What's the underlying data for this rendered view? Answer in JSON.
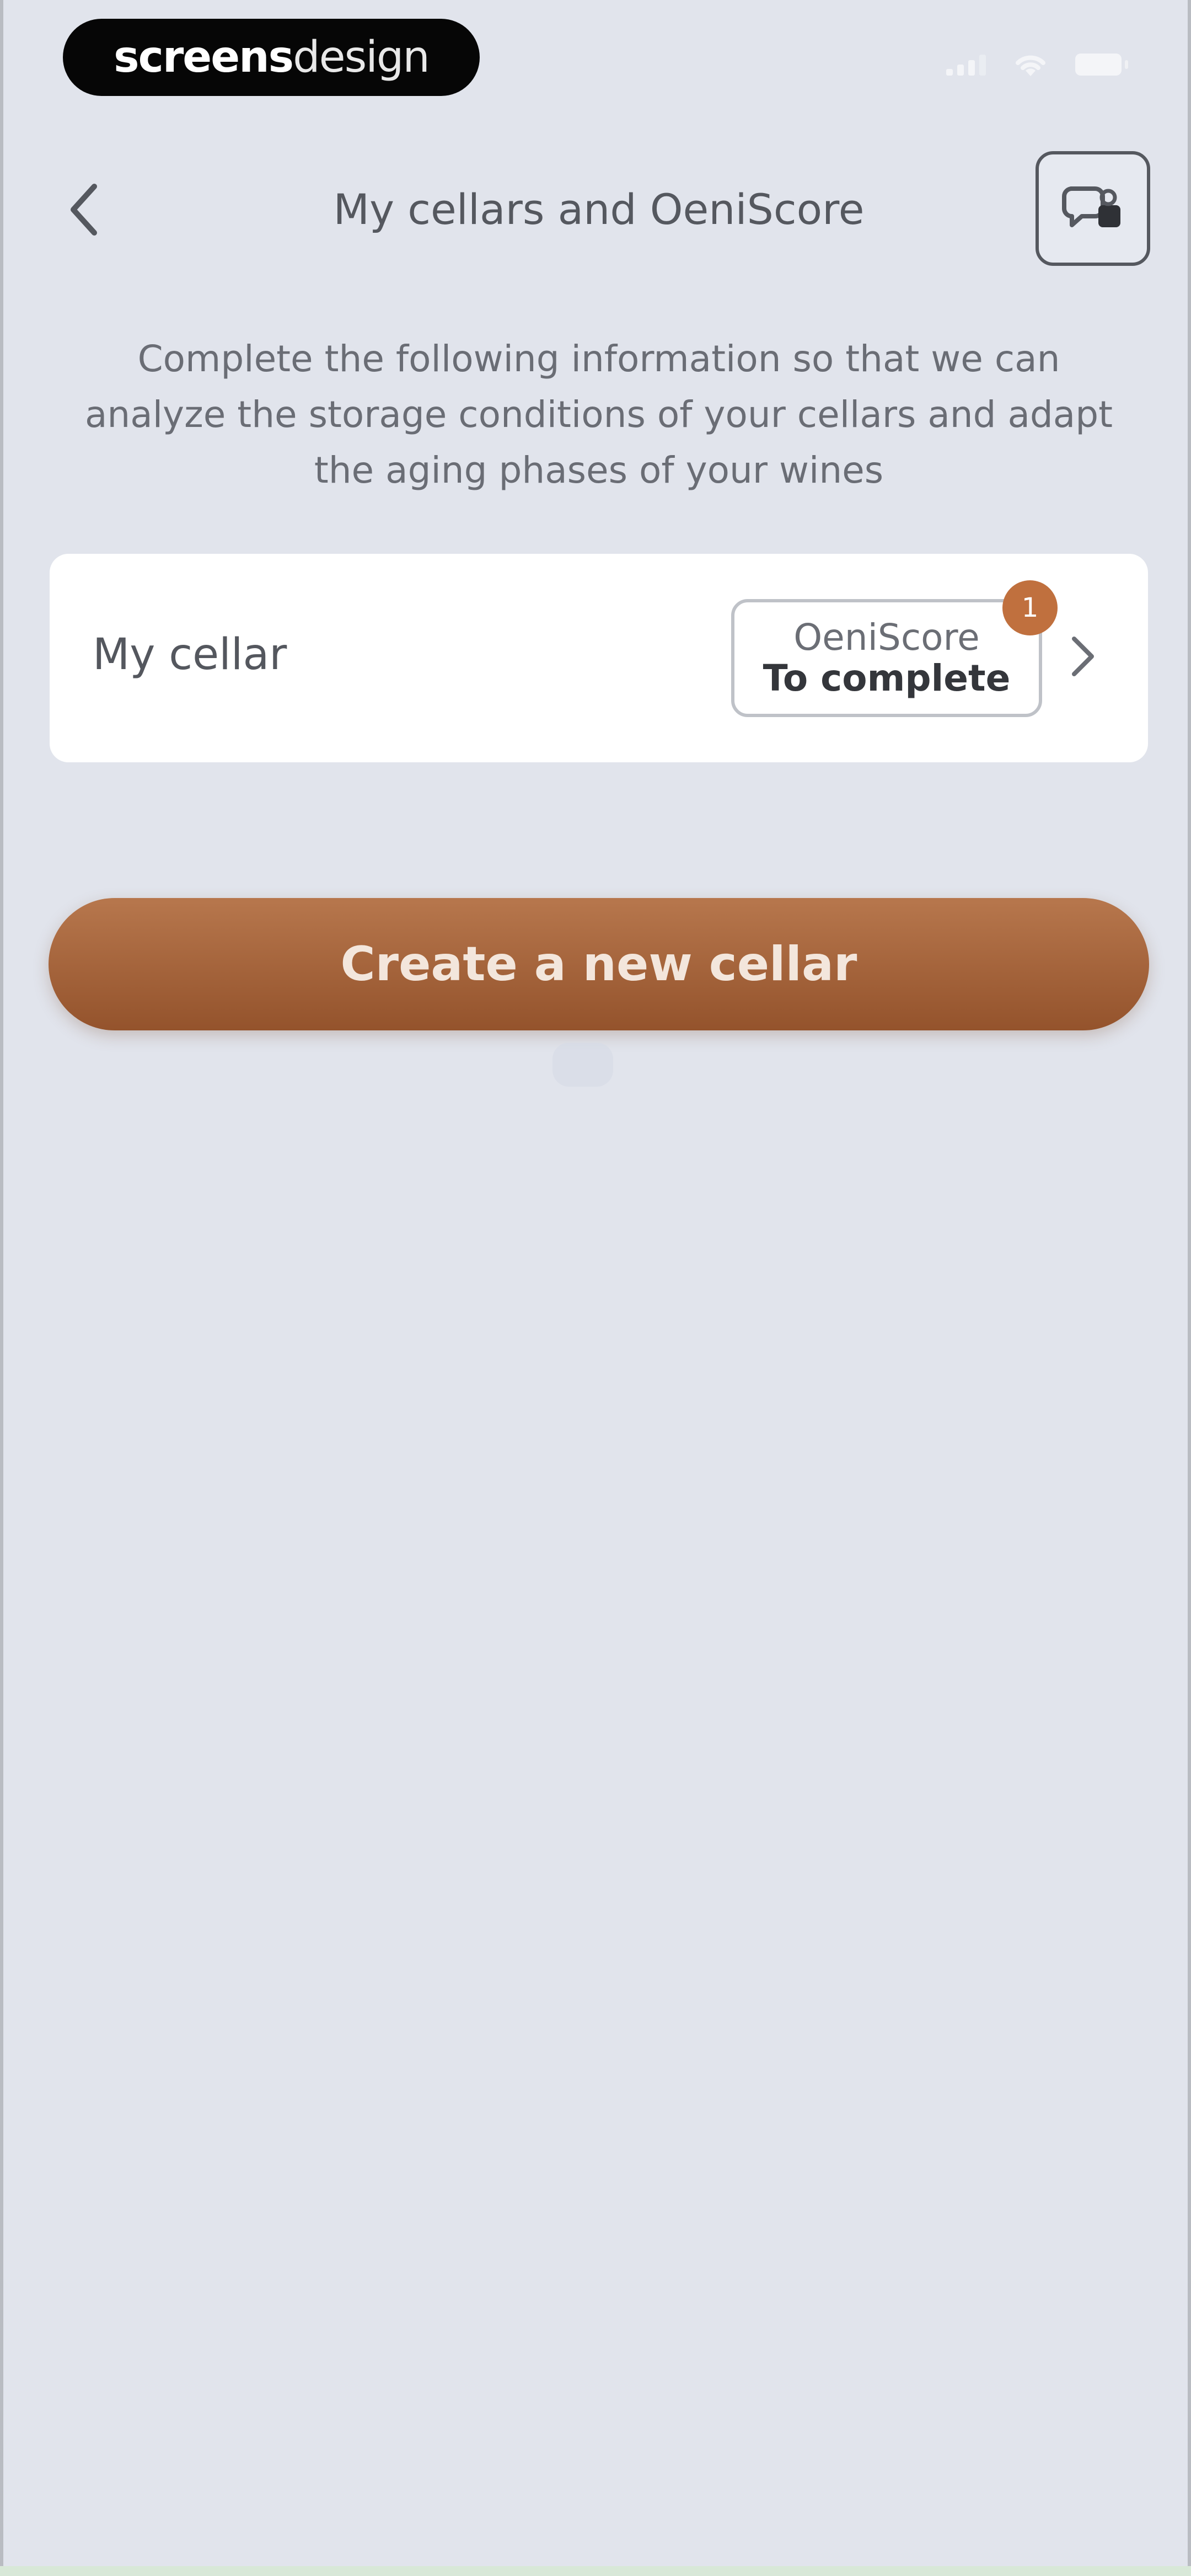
{
  "status_bar": {
    "brand_bold": "screens",
    "brand_light": "design"
  },
  "header": {
    "title": "My cellars and OeniScore"
  },
  "intro": {
    "text": "Complete the following information so that we can analyze the storage conditions of your cellars and adapt the aging phases of your wines"
  },
  "cellars": [
    {
      "name": "My cellar",
      "oeniscore_label": "OeniScore",
      "oeniscore_status": "To complete",
      "notification_count": "1"
    }
  ],
  "actions": {
    "create_label": "Create a new cellar"
  },
  "colors": {
    "accent": "#a8663d",
    "background": "#e1e4ec",
    "card": "#ffffff",
    "badge": "#c0703e"
  },
  "icons": {
    "back": "chevron-left-icon",
    "help": "chat-help-icon",
    "row_arrow": "chevron-right-icon"
  }
}
